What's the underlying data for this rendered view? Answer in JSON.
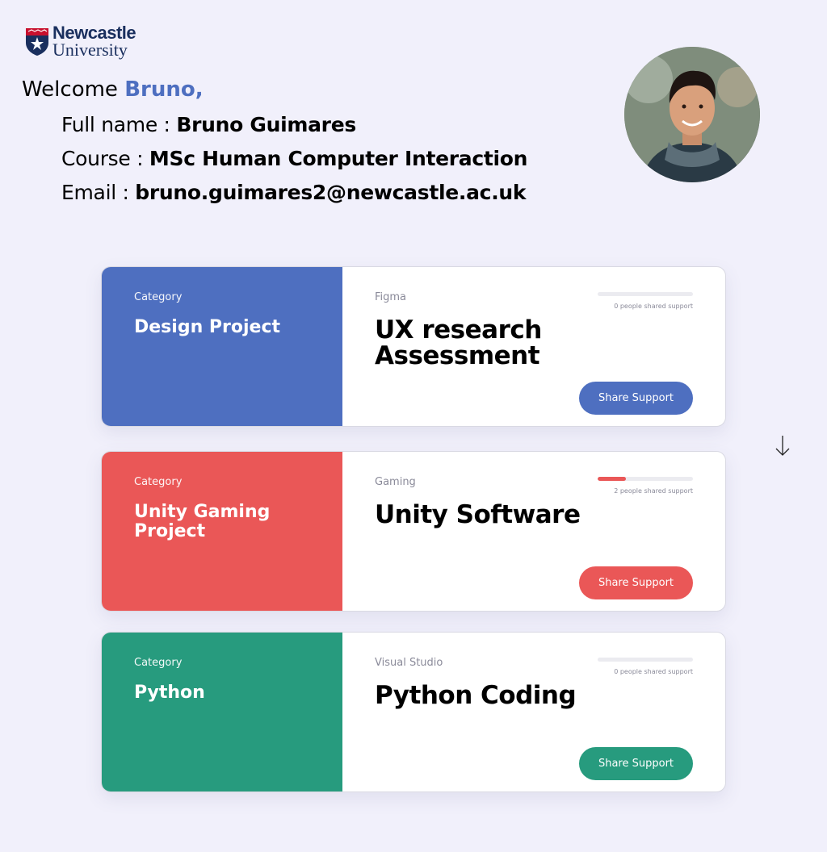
{
  "logo": {
    "line1": "Newcastle",
    "line2": "University"
  },
  "welcome": {
    "greeting": "Welcome ",
    "name": "Bruno,"
  },
  "profile": {
    "full_name_label": "Full name : ",
    "full_name": "Bruno Guimares",
    "course_label": "Course : ",
    "course": "MSc Human Computer Interaction",
    "email_label": "Email : ",
    "email": "bruno.guimares2@newcastle.ac.uk"
  },
  "colors": {
    "blue": "#4e6fc0",
    "red": "#ea5757",
    "green": "#279b7e"
  },
  "cards": [
    {
      "category_label": "Category",
      "category": "Design Project",
      "tool": "Figma",
      "title": "UX research Assessment",
      "support_text": "0 people shared support",
      "support_fraction": 0,
      "button_label": "Share Support",
      "color": "#4e6fc0"
    },
    {
      "category_label": "Category",
      "category": "Unity Gaming Project",
      "tool": "Gaming",
      "title": "Unity Software",
      "support_text": "2 people shared support",
      "support_fraction": 0.3,
      "button_label": "Share Support",
      "color": "#ea5757"
    },
    {
      "category_label": "Category",
      "category": "Python",
      "tool": "Visual Studio",
      "title": "Python Coding",
      "support_text": "0 people shared support",
      "support_fraction": 0,
      "button_label": "Share Support",
      "color": "#279b7e"
    }
  ],
  "icons": {
    "arrow": "arrow-down-icon",
    "crest": "university-crest-icon"
  }
}
